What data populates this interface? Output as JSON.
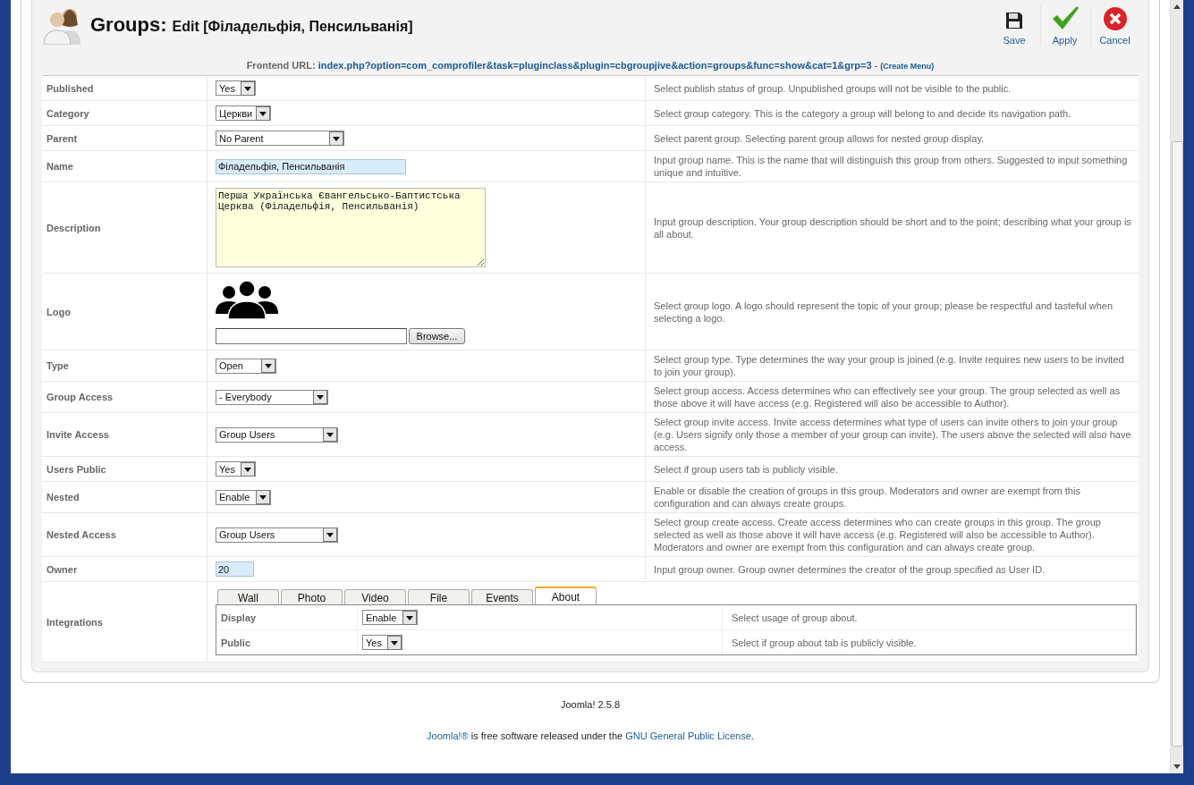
{
  "header": {
    "title": "Groups:",
    "subtitle": "Edit [Філадельфія, Пенсильванія]"
  },
  "toolbar": [
    {
      "label": "Save",
      "kind": "save"
    },
    {
      "label": "Apply",
      "kind": "apply"
    },
    {
      "label": "Cancel",
      "kind": "cancel"
    }
  ],
  "frontend_url": {
    "label": "Frontend URL:",
    "url": "index.php?option=com_comprofiler&task=pluginclass&plugin=cbgroupjive&action=groups&func=show&cat=1&grp=3",
    "separator": " - ",
    "link": "(Create Menu)"
  },
  "fields": [
    {
      "label": "Published",
      "kind": "select",
      "value": "Yes",
      "help": "Select publish status of group. Unpublished groups will not be visible to the public."
    },
    {
      "label": "Category",
      "kind": "select",
      "value": "Церкви",
      "help": "Select group category. This is the category a group will belong to and decide its navigation path."
    },
    {
      "label": "Parent",
      "kind": "select",
      "value": "No Parent",
      "help": "Select parent group. Selecting parent group allows for nested group display."
    },
    {
      "label": "Name",
      "kind": "text",
      "value": "Філадельфія, Пенсильванія",
      "help": "Input group name. This is the name that will distinguish this group from others. Suggested to input something unique and intuitive."
    },
    {
      "label": "Description",
      "kind": "textarea",
      "value": "Перша Українська Євангельсько-Баптистська Церква (Філадельфія, Пенсильванія)",
      "help": "Input group description. Your group description should be short and to the point; describing what your group is all about."
    },
    {
      "label": "Logo",
      "kind": "logo",
      "button": "Browse...",
      "help": "Select group logo. A logo should represent the topic of your group; please be respectful and tasteful when selecting a logo."
    },
    {
      "label": "Type",
      "kind": "select",
      "value": "Open",
      "help": "Select group type. Type determines the way your group is joined (e.g. Invite requires new users to be invited to join your group)."
    },
    {
      "label": "Group Access",
      "kind": "select",
      "value": "- Everybody",
      "help": "Select group access. Access determines who can effectively see your group. The group selected as well as those above it will have access (e.g. Registered will also be accessible to Author)."
    },
    {
      "label": "Invite Access",
      "kind": "select",
      "value": "Group Users",
      "help": "Select group invite access. Invite access determines what type of users can invite others to join your group (e.g. Users signify only those a member of your group can invite). The users above the selected will also have access."
    },
    {
      "label": "Users Public",
      "kind": "select",
      "value": "Yes",
      "help": "Select if group users tab is publicly visible."
    },
    {
      "label": "Nested",
      "kind": "select",
      "value": "Enable",
      "help": "Enable or disable the creation of groups in this group. Moderators and owner are exempt from this configuration and can always create groups."
    },
    {
      "label": "Nested Access",
      "kind": "select",
      "value": "Group Users",
      "help": "Select group create access. Create access determines who can create groups in this group. The group selected as well as those above it will have access (e.g. Registered will also be accessible to Author). Moderators and owner are exempt from this configuration and can always create group."
    },
    {
      "label": "Owner",
      "kind": "short",
      "value": "20",
      "help": "Input group owner. Group owner determines the creator of the group specified as User ID."
    }
  ],
  "integrations": {
    "label": "Integrations",
    "tabs": [
      {
        "label": "Wall",
        "selected": false
      },
      {
        "label": "Photo",
        "selected": false
      },
      {
        "label": "Video",
        "selected": false
      },
      {
        "label": "File",
        "selected": false
      },
      {
        "label": "Events",
        "selected": false
      },
      {
        "label": "About",
        "selected": true
      }
    ],
    "rows": [
      {
        "label": "Display",
        "value": "Enable",
        "help": "Select usage of group about."
      },
      {
        "label": "Public",
        "value": "Yes",
        "help": "Select if group about tab is publicly visible."
      }
    ]
  },
  "footer": {
    "version": "Joomla! 2.5.8",
    "link": "Joomla!®",
    "text": " is free software released under the ",
    "license": "GNU General Public License",
    "end": "."
  }
}
